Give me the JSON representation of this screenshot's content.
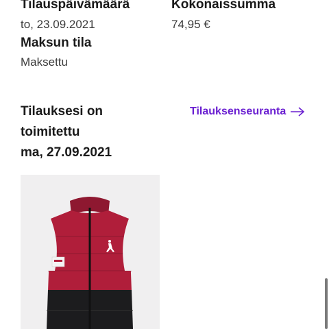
{
  "order": {
    "date_label": "Tilauspäivämäärä",
    "date_value": "to, 23.09.2021",
    "payment_label": "Maksun tila",
    "payment_value": "Maksettu",
    "total_label": "Kokonaissumma",
    "total_value": "74,95 €"
  },
  "delivery": {
    "status_text": "Tilauksesi on toimitettu",
    "date": "ma, 27.09.2021",
    "tracking_link": "Tilauksenseuranta",
    "tracking_icon": "arrow-right-icon"
  },
  "product": {
    "image_desc": "red-black-jordan-vest"
  },
  "colors": {
    "accent": "#6a1fd1",
    "vest_red": "#b01e3a",
    "vest_black": "#1c1c1e"
  }
}
